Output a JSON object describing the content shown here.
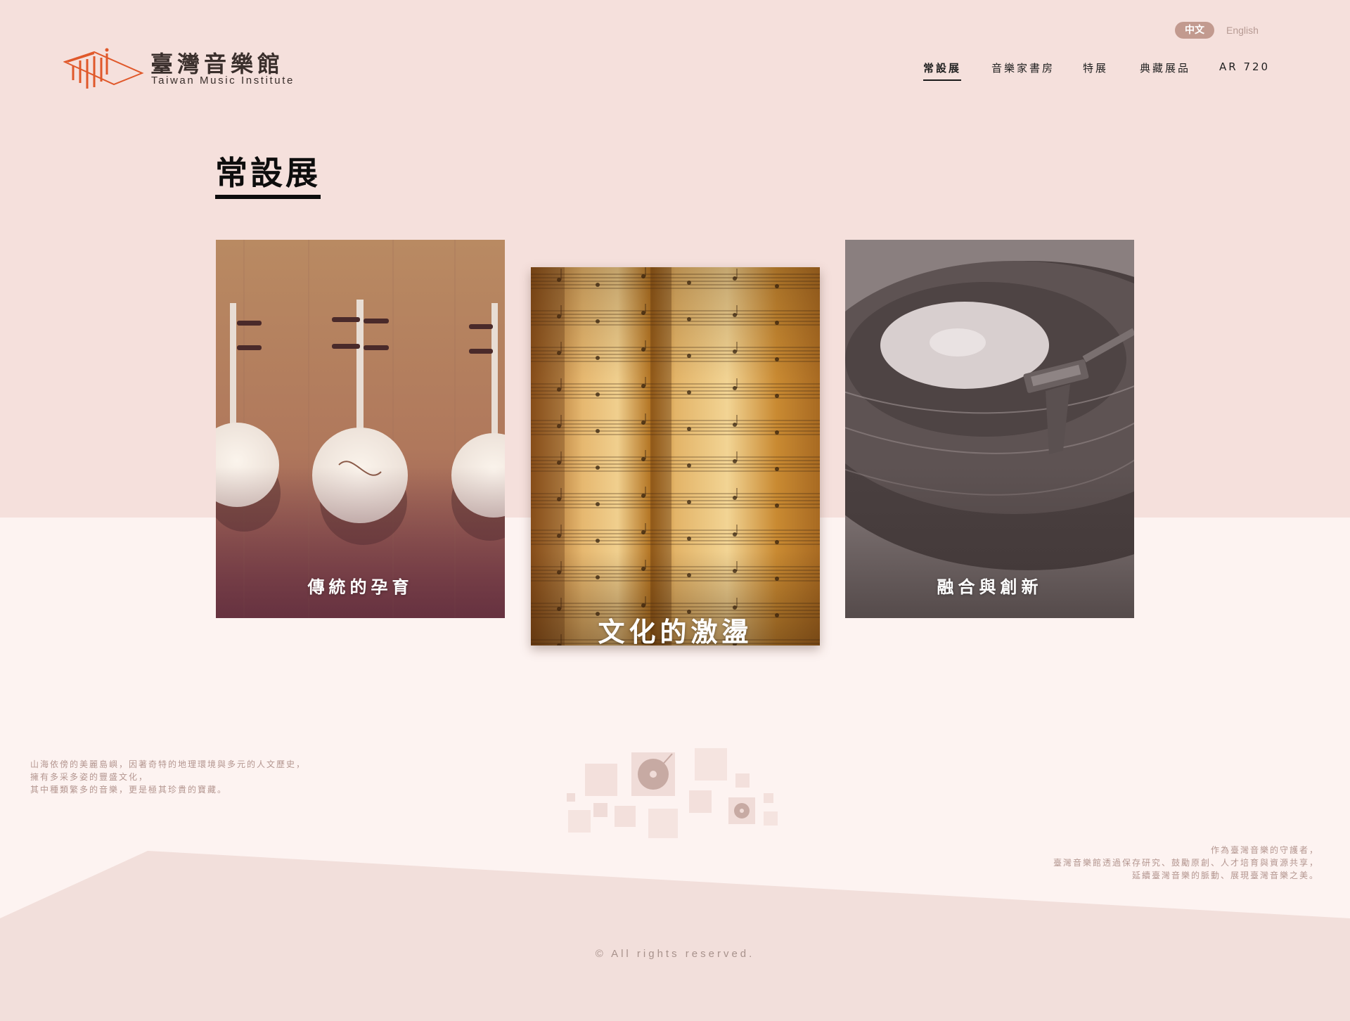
{
  "brand": {
    "name_cn": "臺灣音樂館",
    "name_en": "Taiwan Music Institute",
    "logo_letters": "tmi",
    "accent_color": "#e0582a"
  },
  "language": {
    "zh_label": "中文",
    "en_label": "English",
    "active": "中文"
  },
  "nav": {
    "items": [
      {
        "label": "常設展",
        "active": true
      },
      {
        "label": "音樂家書房",
        "active": false
      },
      {
        "label": "特展",
        "active": false
      },
      {
        "label": "典藏展品",
        "active": false
      },
      {
        "label": "AR 720",
        "active": false
      }
    ]
  },
  "main": {
    "title": "常設展",
    "cards": [
      {
        "label": "傳統的孕育",
        "image": "traditional-instruments-photo",
        "featured": false
      },
      {
        "label": "文化的激盪",
        "image": "sheet-music-photo",
        "featured": true
      },
      {
        "label": "融合與創新",
        "image": "vinyl-record-photo",
        "featured": false
      }
    ]
  },
  "footer": {
    "intro_left": [
      "山海依傍的美麗島嶼，因著奇特的地理環境與多元的人文歷史，",
      "擁有多采多姿的豐盛文化，",
      "其中種類繁多的音樂，更是極其珍貴的寶藏。"
    ],
    "intro_right": [
      "作為臺灣音樂的守護者，",
      "臺灣音樂館透過保存研究、鼓勵原創、人才培育與資源共享，",
      "延續臺灣音樂的脈動、展現臺灣音樂之美。"
    ],
    "copyright": "© All rights reserved."
  },
  "colors": {
    "bg_top": "#f5e0dc",
    "bg_bottom": "#fdf3f1",
    "footer_band": "#f2dfdb",
    "lang_pill": "#c29a8f"
  }
}
